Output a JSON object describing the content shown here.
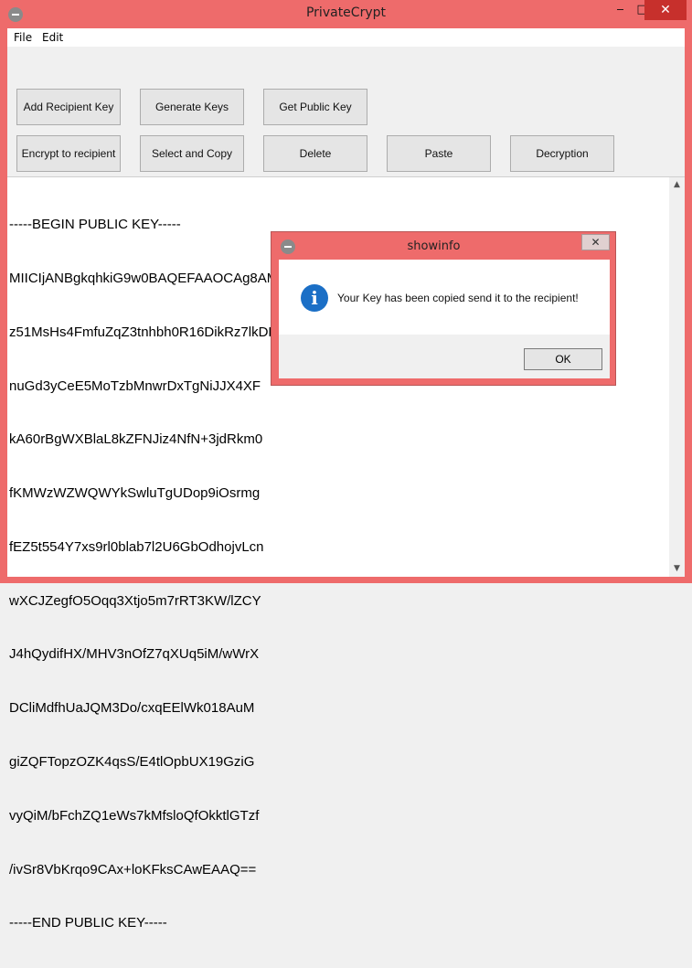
{
  "window": {
    "title": "PrivateCrypt",
    "controls": {
      "minimize": "‒",
      "maximize": "□",
      "close": "✕"
    }
  },
  "menu": [
    "File",
    "Edit"
  ],
  "toolbar": {
    "row1": [
      "Add Recipient Key",
      "Generate Keys",
      "Get Public Key"
    ],
    "row2": [
      "Encrypt to recipient",
      "Select and Copy",
      "Delete",
      "Paste",
      "Decryption"
    ]
  },
  "editor": {
    "lines": [
      "-----BEGIN PUBLIC KEY-----",
      "MIICIjANBgkqhkiG9w0BAQEFAAOCAg8AMIICCgKCAgEA3R8LcAqhggAcbjYp+pIW",
      "z51MsHs4FmfuZqZ3tnhbh0R16DikRz7lkDDSVmL7rckrvpOHcPGl1ZxZAROKhFke",
      "nuGd3yCeE5MoTzbMnwrDxTgNiJJX4XF",
      "kA60rBgWXBlaL8kZFNJiz4NfN+3jdRkm0",
      "fKMWzWZWQWYkSwluTgUDop9iOsrmg",
      "fEZ5t554Y7xs9rl0blab7l2U6GbOdhojvLcn",
      "wXCJZegfO5Oqq3Xtjo5m7rRT3KW/lZCY",
      "J4hQydifHX/MHV3nOfZ7qXUq5iM/wWrX",
      "DCliMdfhUaJQM3Do/cxqEElWk018AuM",
      "giZQFTopzOZK4qsS/E4tlOpbUX19GziG",
      "vyQiM/bFchZQ1eWs7kMfsloQfOkktlGTzf",
      "/ivSr8VbKrqo9CAx+loKFksCAwEAAQ==",
      "-----END PUBLIC KEY-----"
    ]
  },
  "dialog": {
    "title": "showinfo",
    "close": "✕",
    "message": "Your Key has been copied send it to the recipient!",
    "ok_label": "OK",
    "icon": "information-icon"
  },
  "colors": {
    "title_bar": "#ee6b6b",
    "close_button": "#c7302c",
    "info_icon": "#1b6fc6"
  }
}
